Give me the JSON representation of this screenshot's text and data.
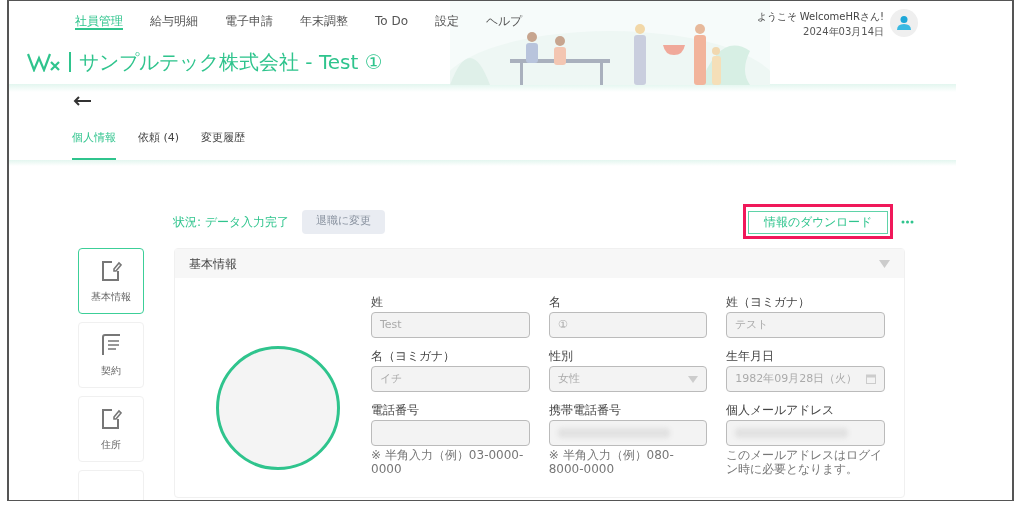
{
  "nav": {
    "items": [
      {
        "label": "社員管理",
        "selected": true
      },
      {
        "label": "給与明細",
        "selected": false
      },
      {
        "label": "電子申請",
        "selected": false
      },
      {
        "label": "年末調整",
        "selected": false
      },
      {
        "label": "To Do",
        "selected": false
      },
      {
        "label": "設定",
        "selected": false
      },
      {
        "label": "ヘルプ",
        "selected": false
      }
    ]
  },
  "user": {
    "welcome": "ようこそ WelcomeHRさん!",
    "date": "2024年03月14日"
  },
  "company_title": "サンプルテック株式会社 - Test ①",
  "tabs": [
    {
      "label": "個人情報",
      "selected": true
    },
    {
      "label": "依頼 (4)",
      "selected": false
    },
    {
      "label": "変更履歴",
      "selected": false
    }
  ],
  "status": {
    "text": "状況: データ入力完了",
    "retire_button": "退職に変更",
    "download_button": "情報のダウンロード",
    "download_highlighted": true
  },
  "sidebar": {
    "items": [
      {
        "label": "基本情報",
        "kind": "edit",
        "selected": true
      },
      {
        "label": "契約",
        "kind": "list",
        "selected": false
      },
      {
        "label": "住所",
        "kind": "edit",
        "selected": false
      }
    ]
  },
  "section": {
    "title": "基本情報",
    "expanded": true,
    "fields": [
      {
        "label": "姓",
        "kind": "text",
        "value": "Test"
      },
      {
        "label": "名",
        "kind": "text",
        "value": "①"
      },
      {
        "label": "姓（ヨミガナ）",
        "kind": "text",
        "value": "テスト"
      },
      {
        "label": "名（ヨミガナ）",
        "kind": "text",
        "value": "イチ"
      },
      {
        "label": "性別",
        "kind": "select",
        "value": "女性"
      },
      {
        "label": "生年月日",
        "kind": "date",
        "value": "1982年09月28日（火）"
      },
      {
        "label": "電話番号",
        "kind": "text",
        "hint": "※ 半角入力（例）03-0000-0000"
      },
      {
        "label": "携帯電話番号",
        "kind": "redacted",
        "hint": "※ 半角入力（例）080-8000-0000"
      },
      {
        "label": "個人メールアドレス",
        "kind": "redacted",
        "hint": "このメールアドレスはログイン時に必要となります。"
      }
    ]
  }
}
